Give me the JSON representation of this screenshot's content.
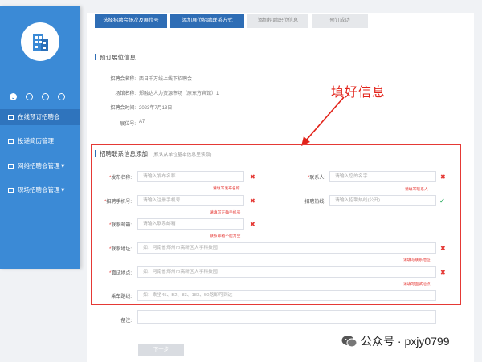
{
  "sidebar": {
    "items": [
      {
        "label": "在线预订招聘会"
      },
      {
        "label": "投递简历管理"
      },
      {
        "label": "网络招聘会管理▼"
      },
      {
        "label": "现场招聘会管理▼"
      }
    ]
  },
  "steps": [
    {
      "label": "选择招聘会场次及展位号",
      "state": "done"
    },
    {
      "label": "添加展位招聘联系方式",
      "state": "done"
    },
    {
      "label": "添加招聘职位信息",
      "state": "todo"
    },
    {
      "label": "预订成功",
      "state": "todo"
    }
  ],
  "booking": {
    "title": "预订展位信息",
    "rows": [
      {
        "label": "招聘会名称:",
        "value": "西日千万线上线下招聘会"
      },
      {
        "label": "场馆名称:",
        "value": "郑融达人力资源市场（原东方宾馆）1"
      },
      {
        "label": "招聘会时间:",
        "value": "2023年7月13日"
      },
      {
        "label": "展位号:",
        "value": "A7"
      }
    ]
  },
  "annotation": "填好信息",
  "contact": {
    "title": "招聘联系信息添加",
    "subtitle": "(默认从单位基本信息里读取)",
    "fields": {
      "name": {
        "label": "发布名称:",
        "placeholder": "请输入发布名称",
        "error": "请填写发布名称"
      },
      "contact_person": {
        "label": "联系人:",
        "placeholder": "请输入您的名字",
        "error": "请填写联系人"
      },
      "mobile": {
        "label": "招聘手机号:",
        "placeholder": "请输入注册手机号",
        "error": "请填写正确手机号"
      },
      "landline": {
        "label": "招聘热线:",
        "placeholder": "请输入招聘热线(公开)"
      },
      "email": {
        "label": "联系邮箱:",
        "placeholder": "请输入联系邮箱",
        "error": "联系邮箱不能为空"
      },
      "address": {
        "label": "联系地址:",
        "placeholder": "如：河南省郑州市高新区大学科技园",
        "error": "请填写联系地址"
      },
      "interview": {
        "label": "面试地点:",
        "placeholder": "如：河南省郑州市高新区大学科技园",
        "error": "请填写面试地点"
      },
      "bus": {
        "label": "乘车路线:",
        "placeholder": "如：乘坐45、B2、83、183、50路即可到达"
      }
    }
  },
  "remark": {
    "label": "备注:"
  },
  "next_label": "下一步",
  "watermark": "公众号 · pxjy0799"
}
